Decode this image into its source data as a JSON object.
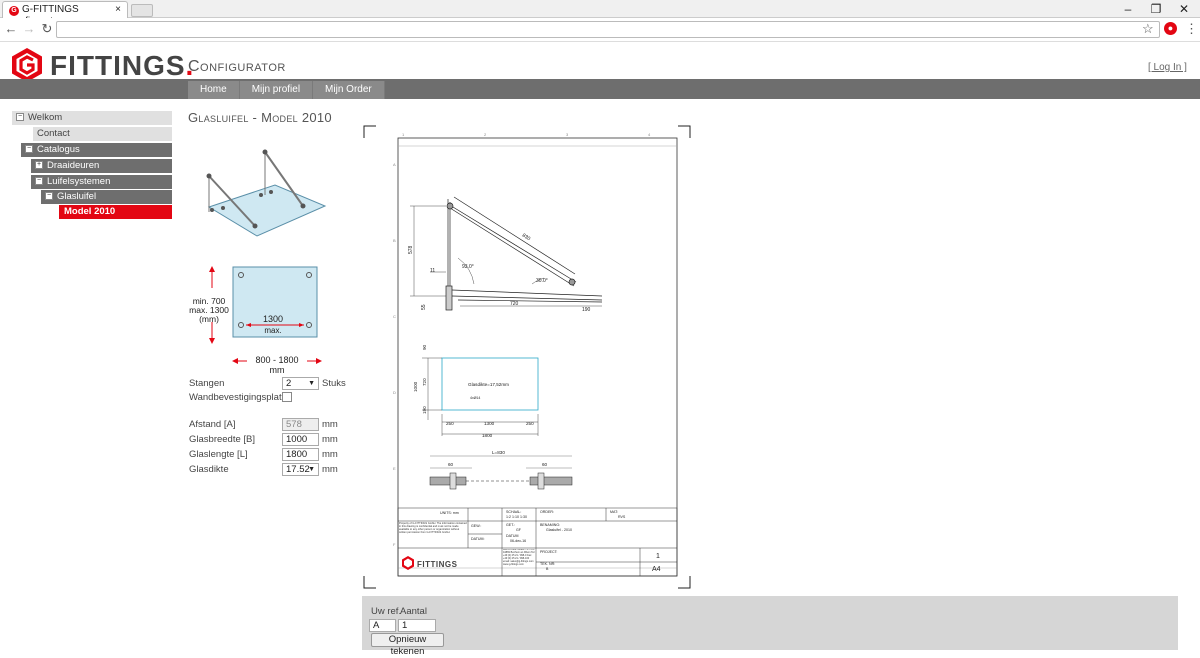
{
  "browser": {
    "tab_title": "G-FITTINGS configurator",
    "tab_close": "×",
    "window_controls": [
      "–",
      "❐",
      "✕"
    ]
  },
  "header": {
    "logo_text": "FITTINGS",
    "logo_dot": ".",
    "title": "Configurator",
    "login_label": "[ Log In ]"
  },
  "nav": {
    "items": [
      "Home",
      "Mijn profiel",
      "Mijn Order"
    ]
  },
  "tree": {
    "items": [
      {
        "label": "Welkom",
        "toggle": "−"
      },
      {
        "label": "Contact"
      },
      {
        "label": "Catalogus",
        "toggle": "−"
      },
      {
        "label": "Draaideuren",
        "toggle": "+"
      },
      {
        "label": "Luifelsystemen",
        "toggle": "−"
      },
      {
        "label": "Glasluifel",
        "toggle": "−"
      },
      {
        "label": "Model 2010"
      }
    ]
  },
  "product": {
    "title": "Glasluifel - Model 2010",
    "dim_height": "min. 700\nmax. 1300\n(mm)",
    "dim_inner": "1300",
    "dim_inner_sub": "max.",
    "dim_width": "800 - 1800 mm"
  },
  "options": {
    "stangen_label": "Stangen",
    "stangen_value": "2",
    "stangen_unit": "Stuks",
    "wand_label": "Wandbevestigingsplaten",
    "wand_checked": false
  },
  "fields": [
    {
      "label": "Afstand [A]",
      "value": "578",
      "unit": "mm",
      "disabled": true
    },
    {
      "label": "Glasbreedte [B]",
      "value": "1000",
      "unit": "mm"
    },
    {
      "label": "Glaslengte [L]",
      "value": "1800",
      "unit": "mm"
    },
    {
      "label": "Glasdikte",
      "value": "17.52",
      "unit": "mm",
      "select": true
    }
  ],
  "drawing": {
    "dims": {
      "diag": "830",
      "h": "578",
      "a1": "93.0°",
      "a2": "30.0°",
      "d11": "11",
      "l720": "720",
      "l190": "190",
      "d55": "55",
      "glass_h": "1000",
      "glass_720": "720",
      "glass_90": "90",
      "glass_190": "190",
      "glass_label": "Glasdikte=17,52mm",
      "glass_hole": "4xØ14",
      "g250a": "250",
      "g1300": "1300",
      "g250b": "250",
      "g1800": "1800",
      "rod_l": "L=830",
      "rod60a": "60",
      "rod60b": "60"
    },
    "ruler_top": [
      "1",
      "2",
      "3",
      "4"
    ],
    "ruler_side": [
      "A",
      "B",
      "C",
      "D",
      "E",
      "F"
    ],
    "tb": {
      "units": "UNITS: mm",
      "schaal_lbl": "SCHAAL:",
      "schaal": "1:2 1:10 1:30",
      "order_lbl": "ORDER:",
      "mat_lbl": "MAT:",
      "mat": "RVS",
      "gew_lbl": "GEW.:",
      "get_lbl": "GET.:",
      "get": "GF",
      "datum_lbl": "DATUM:",
      "datum_lbl2": "DATUM",
      "datum": "06-dec-16",
      "benaming_lbl": "BENAMING:",
      "benaming": "Glasluifel - 2010",
      "project_lbl": "PROJECT:",
      "teknr_lbl": "TEK. NR:",
      "teknr": "B",
      "sheet": "1",
      "size": "A4",
      "logo": "FITTINGS",
      "property": "Property of G-FITTINGS GmbH. The information contained in this drawing is confidential and must not be made available to any other person or organization without written permission from G-FITTINGS GmbH.",
      "address": "Metro-Cube-Straße 74-74 D-44869 Bochum an Rhein Tel: +49 (0) 25 21 / 998-0 Fax: +49 (0) 25 21 / 998-100 email: sales@g-fittings.com www.g-fittings.com"
    }
  },
  "order": {
    "ref_label": "Uw ref.",
    "ref_value": "A",
    "aantal_label": "Aantal",
    "aantal_value": "1",
    "redraw_label": "Opnieuw tekenen"
  },
  "colors": {
    "accent": "#e30613",
    "nav": "#8a8a8a",
    "panel": "#d6d6d6"
  }
}
